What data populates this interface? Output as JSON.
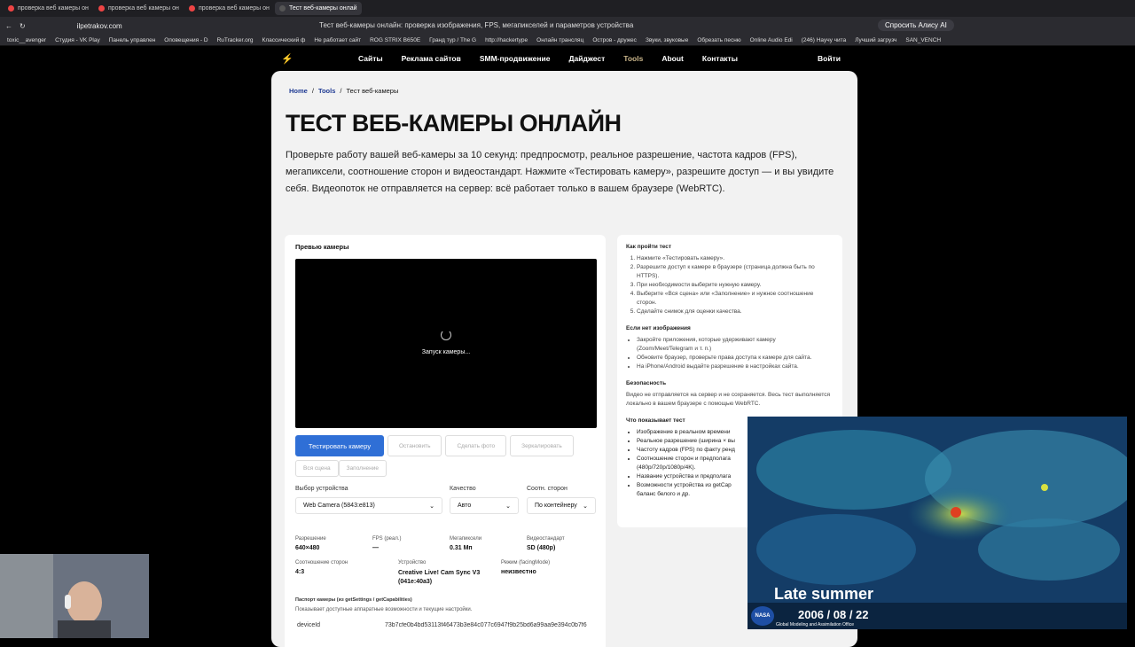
{
  "browser": {
    "tabs": [
      {
        "title": "проверка веб камеры он"
      },
      {
        "title": "проверка веб камеры он"
      },
      {
        "title": "проверка веб камеры он"
      },
      {
        "title": "Тест веб-камеры онлай"
      }
    ],
    "url": "ilpetrakov.com",
    "page_title": "Тест веб-камеры онлайн: проверка изображения, FPS, мегапикселей и параметров устройства",
    "alice_label": "Спросить Алису AI",
    "bookmarks": [
      "toxic__avenger",
      "Студия - VK Play",
      "Панель управлен",
      "Оповещения - D",
      "RuTracker.org",
      "Классический ф",
      "Не работает сайт",
      "ROG STRIX B650E",
      "Гранд тур / The G",
      "http://hackertype",
      "Онлайн трансляц",
      "Остров - дружес",
      "Звуки, звуковые",
      "Обрезать песню",
      "Online Audio Edi",
      "(246) Научу чита",
      "Лучший загрузч",
      "SAN_VENCH"
    ]
  },
  "site_nav": {
    "logo": "⚡",
    "links": [
      "Сайты",
      "Реклама сайтов",
      "SMM-продвижение",
      "Дайджест",
      "Tools",
      "About",
      "Контакты"
    ],
    "login": "Войти"
  },
  "breadcrumb": {
    "home": "Home",
    "sep": "/",
    "tools": "Tools",
    "current": "Тест веб-камеры"
  },
  "page": {
    "title": "ТЕСТ ВЕБ-КАМЕРЫ ОНЛАЙН",
    "intro": "Проверьте работу вашей веб-камеры за 10 секунд: предпросмотр, реальное разрешение, частота кадров (FPS), мегапиксели, соотношение сторон и видеостандарт. Нажмите «Тестировать камеру», разрешите доступ — и вы увидите себя. Видеопоток не отправляется на сервер: всё работает только в вашем браузере (WebRTC)."
  },
  "preview": {
    "title": "Превью камеры",
    "loading": "Запуск камеры...",
    "buttons": {
      "test": "Тестировать камеру",
      "stop": "Остановить",
      "snapshot": "Сделать фото",
      "mirror": "Зеркалировать",
      "full": "Вся сцена",
      "fill": "Заполнение"
    },
    "device_label": "Выбор устройства",
    "device_value": "Web Camera (5843:e813)",
    "quality_label": "Качество",
    "quality_value": "Авто",
    "aspect_label": "Соотн. сторон",
    "aspect_value": "По контейнеру",
    "stats": {
      "res_label": "Разрешение",
      "res_value": "640×480",
      "fps_label": "FPS (реал.)",
      "fps_value": "—",
      "mp_label": "Мегапиксели",
      "mp_value": "0.31 Мп",
      "std_label": "Видеостандарт",
      "std_value": "SD (480p)",
      "ratio_label": "Соотношение сторон",
      "ratio_value": "4:3",
      "dev_label": "Устройство",
      "dev_value": "Creative Live! Cam Sync V3 (041e:40a3)",
      "mode_label": "Режим (facingMode)",
      "mode_value": "неизвестно"
    },
    "passport_title": "Паспорт камеры (из getSettings / getCapabilities)",
    "passport_desc": "Показывает доступные аппаратные возможности и текущие настройки.",
    "passport_key": "deviceId",
    "passport_val": "73b7cfe0b4bd53113f46473b3e84c077c6947f9b25bd6a99aa9e394c0b7f6"
  },
  "howto": {
    "title": "Как пройти тест",
    "steps": [
      "Нажмите «Тестировать камеру».",
      "Разрешите доступ к камере в браузере (страница должна быть по HTTPS).",
      "При необходимости выберите нужную камеру.",
      "Выберите «Вся сцена» или «Заполнение» и нужное соотношение сторон.",
      "Сделайте снимок для оценки качества."
    ],
    "noimg_title": "Если нет изображения",
    "noimg": [
      "Закройте приложения, которые удерживают камеру (Zoom/Meet/Telegram и т. п.)",
      "Обновите браузер, проверьте права доступа к камере для сайта.",
      "На iPhone/Android выдайте разрешение в настройках сайта."
    ],
    "sec_title": "Безопасность",
    "sec_text": "Видео не отправляется на сервер и не сохраняется. Весь тест выполняется локально в вашем браузере с помощью WebRTC.",
    "shows_title": "Что показывает тест",
    "shows": [
      "Изображение в реальном времени",
      "Реальное разрешение (ширина × вы",
      "Частоту кадров (FPS) по факту ренд",
      "Соотношение сторон и предполага",
      "(480p/720p/1080p/4K).",
      "Название устройства и предполага",
      "Возможности устройства из getCap",
      "баланс белого и др."
    ]
  },
  "overlay": {
    "caption": "Late summer",
    "date": "2006 / 08 / 22",
    "logo": "NASA",
    "org": "Global Modeling and Assimilation Office"
  }
}
